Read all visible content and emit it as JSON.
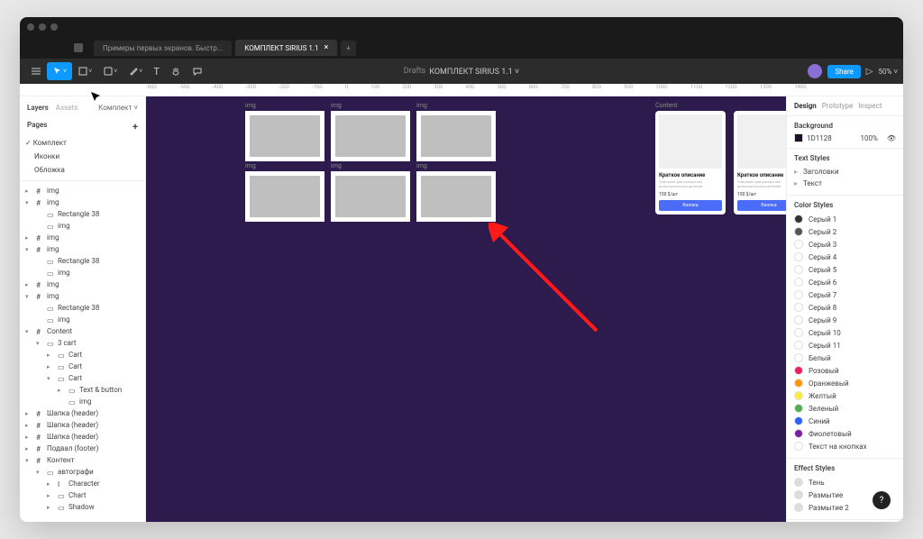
{
  "tabs": [
    {
      "label": "Примеры первых экранов. Быстр..."
    },
    {
      "label": "КОМПЛЕКТ SIRIUS 1.1"
    }
  ],
  "toolbar_title": {
    "drafts": "Drafts",
    "name": "КОМПЛЕКТ SIRIUS 1.1 ˅"
  },
  "share": "Share",
  "zoom": "50% ˅",
  "left": {
    "tab1": "Layers",
    "tab2": "Assets",
    "selector": "Комплект ˅",
    "pages_label": "Pages",
    "pages": [
      "Комплект",
      "Иконки",
      "Обложка"
    ],
    "layers": [
      {
        "t": "img",
        "ind": 0,
        "c": "▸",
        "ic": "#"
      },
      {
        "t": "img",
        "ind": 0,
        "c": "▾",
        "ic": "#"
      },
      {
        "t": "Rectangle 38",
        "ind": 1,
        "c": "",
        "ic": "▭"
      },
      {
        "t": "img",
        "ind": 1,
        "c": "",
        "ic": "▭"
      },
      {
        "t": "img",
        "ind": 0,
        "c": "▸",
        "ic": "#"
      },
      {
        "t": "img",
        "ind": 0,
        "c": "▾",
        "ic": "#"
      },
      {
        "t": "Rectangle 38",
        "ind": 1,
        "c": "",
        "ic": "▭"
      },
      {
        "t": "img",
        "ind": 1,
        "c": "",
        "ic": "▭"
      },
      {
        "t": "img",
        "ind": 0,
        "c": "▸",
        "ic": "#"
      },
      {
        "t": "img",
        "ind": 0,
        "c": "▾",
        "ic": "#"
      },
      {
        "t": "Rectangle 38",
        "ind": 1,
        "c": "",
        "ic": "▭"
      },
      {
        "t": "img",
        "ind": 1,
        "c": "",
        "ic": "▭"
      },
      {
        "t": "Content",
        "ind": 0,
        "c": "▾",
        "ic": "#"
      },
      {
        "t": "3 cart",
        "ind": 1,
        "c": "▾",
        "ic": "▭"
      },
      {
        "t": "Cart",
        "ind": 2,
        "c": "▸",
        "ic": "▭"
      },
      {
        "t": "Cart",
        "ind": 2,
        "c": "▸",
        "ic": "▭"
      },
      {
        "t": "Cart",
        "ind": 2,
        "c": "▾",
        "ic": "▭"
      },
      {
        "t": "Text & button",
        "ind": 3,
        "c": "▸",
        "ic": "▭"
      },
      {
        "t": "img",
        "ind": 3,
        "c": "",
        "ic": "▭"
      },
      {
        "t": "Шапка (header)",
        "ind": 0,
        "c": "▸",
        "ic": "#"
      },
      {
        "t": "Шапка (header)",
        "ind": 0,
        "c": "▸",
        "ic": "#"
      },
      {
        "t": "Шапка (header)",
        "ind": 0,
        "c": "▸",
        "ic": "#"
      },
      {
        "t": "Подвал (footer)",
        "ind": 0,
        "c": "▸",
        "ic": "#"
      },
      {
        "t": "Контент",
        "ind": 0,
        "c": "▾",
        "ic": "#"
      },
      {
        "t": "автографи",
        "ind": 1,
        "c": "▾",
        "ic": "▭"
      },
      {
        "t": "Character",
        "ind": 2,
        "c": "▸",
        "ic": "I"
      },
      {
        "t": "Chart",
        "ind": 2,
        "c": "▸",
        "ic": "▭"
      },
      {
        "t": "Shadow",
        "ind": 2,
        "c": "▸",
        "ic": "▭"
      }
    ]
  },
  "canvas": {
    "img_labels": [
      "img",
      "img",
      "img",
      "img",
      "img",
      "img"
    ],
    "content_label": "Content",
    "card": {
      "title": "Краткое описание",
      "desc": "Описание для раскрытия дополнительных деталей",
      "price": "150 $/шт",
      "btn": "Кнопка"
    }
  },
  "right": {
    "tab1": "Design",
    "tab2": "Prototype",
    "tab3": "Inspect",
    "bg_label": "Background",
    "bg_hex": "1D1128",
    "bg_pct": "100%",
    "text_styles_label": "Text Styles",
    "text_styles": [
      "Заголовки",
      "Текст"
    ],
    "color_styles_label": "Color Styles",
    "colors": [
      {
        "n": "Серый 1",
        "c": "#333"
      },
      {
        "n": "Серый 2",
        "c": "#555"
      },
      {
        "n": "Серый 3",
        "c": ""
      },
      {
        "n": "Серый 4",
        "c": ""
      },
      {
        "n": "Серый 5",
        "c": ""
      },
      {
        "n": "Серый 6",
        "c": ""
      },
      {
        "n": "Серый 7",
        "c": ""
      },
      {
        "n": "Серый 8",
        "c": ""
      },
      {
        "n": "Серый 9",
        "c": ""
      },
      {
        "n": "Серый 10",
        "c": ""
      },
      {
        "n": "Серый 11",
        "c": ""
      },
      {
        "n": "Белый",
        "c": "#fff"
      },
      {
        "n": "Розовый",
        "c": "#e91e63"
      },
      {
        "n": "Оранжевый",
        "c": "#ff9800"
      },
      {
        "n": "Желтый",
        "c": "#ffeb3b"
      },
      {
        "n": "Зеленый",
        "c": "#4caf50"
      },
      {
        "n": "Синий",
        "c": "#2962ff"
      },
      {
        "n": "Фиолетовый",
        "c": "#7b1fa2"
      },
      {
        "n": "Текст на кнопках",
        "c": ""
      }
    ],
    "effect_label": "Effect Styles",
    "effects": [
      "Тень",
      "Размытие",
      "Размытие 2"
    ]
  },
  "ruler": [
    "-600",
    "-500",
    "-400",
    "-300",
    "-200",
    "-100",
    "0",
    "100",
    "200",
    "300",
    "400",
    "500",
    "600",
    "700",
    "800",
    "900",
    "1000",
    "1100",
    "1200",
    "1300",
    "1400"
  ]
}
